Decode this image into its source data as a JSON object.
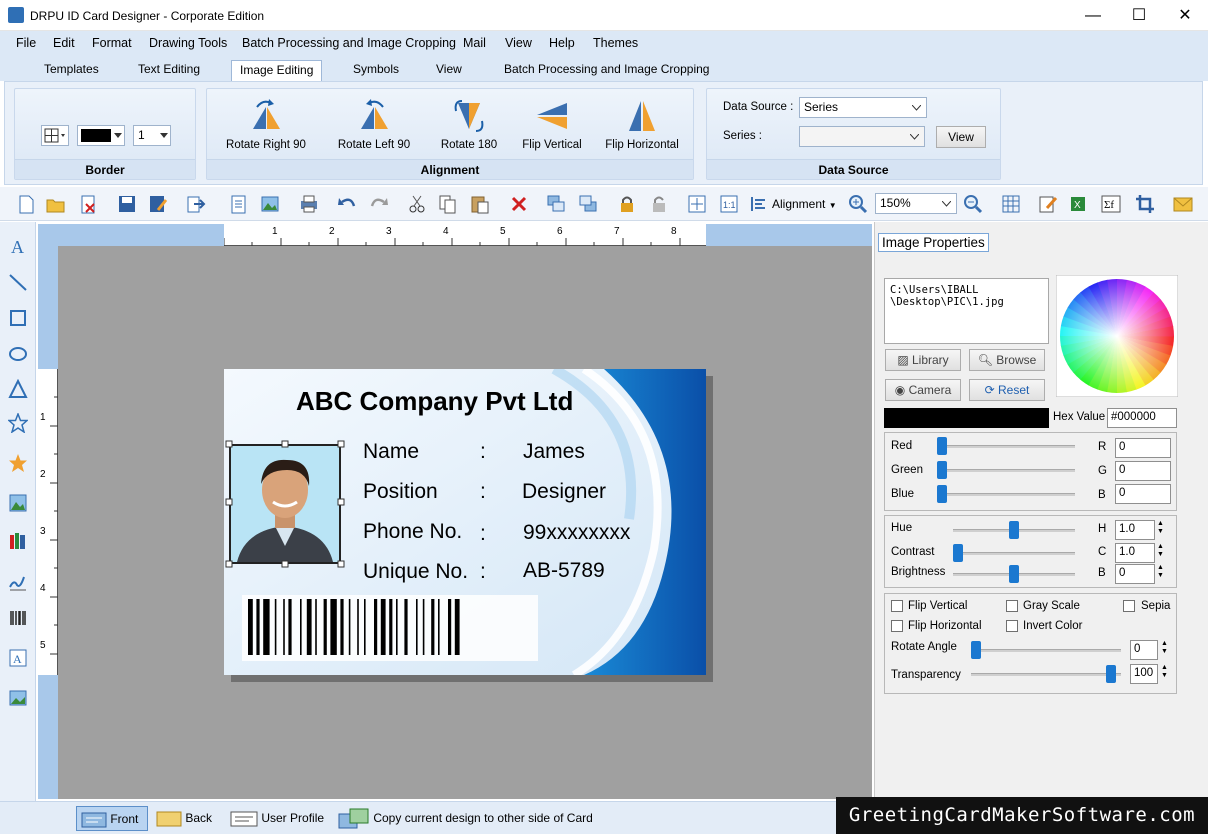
{
  "window": {
    "title": "DRPU ID Card Designer - Corporate Edition",
    "minimize": "—",
    "maximize": "☐",
    "close": "✕"
  },
  "menu": [
    "File",
    "Edit",
    "Format",
    "Drawing Tools",
    "Batch Processing and Image Cropping",
    "Mail",
    "View",
    "Help",
    "Themes"
  ],
  "tabs": [
    "Templates",
    "Text Editing",
    "Image Editing",
    "Symbols",
    "View",
    "Batch Processing and Image Cropping"
  ],
  "active_tab": "Image Editing",
  "ribbon": {
    "border": {
      "label": "Border",
      "color": "#000000",
      "width_value": "1"
    },
    "alignment": {
      "label": "Alignment",
      "buttons": [
        "Rotate Right 90",
        "Rotate Left 90",
        "Rotate 180",
        "Flip Vertical",
        "Flip Horizontal"
      ]
    },
    "data_source": {
      "label": "Data Source",
      "source_label": "Data Source :",
      "source_value": "Series",
      "series_label": "Series :",
      "series_value": "",
      "view_button": "View"
    }
  },
  "toolbar": {
    "alignment_label": "Alignment",
    "zoom": "150%"
  },
  "ruler": {
    "h": [
      "1",
      "2",
      "3",
      "4",
      "5",
      "6",
      "7",
      "8"
    ],
    "v": [
      "1",
      "2",
      "3",
      "4",
      "5"
    ]
  },
  "card": {
    "company": "ABC Company Pvt Ltd",
    "fields": [
      {
        "label": "Name",
        "sep": ":",
        "value": "James"
      },
      {
        "label": "Position",
        "sep": ":",
        "value": "Designer"
      },
      {
        "label": "Phone No.",
        "sep": ":",
        "value": "99xxxxxxxx"
      },
      {
        "label": "Unique No.",
        "sep": ":",
        "value": "AB-5789"
      }
    ]
  },
  "image_properties": {
    "title": "Image Properties",
    "path": "C:\\Users\\IBALL\n\\Desktop\\PIC\\1.jpg",
    "buttons": {
      "library": "Library",
      "browse": "Browse",
      "camera": "Camera",
      "reset": "Reset"
    },
    "hex_label": "Hex Value",
    "hex_value": "#000000",
    "rgb": [
      {
        "name": "Red",
        "key": "R",
        "value": "0"
      },
      {
        "name": "Green",
        "key": "G",
        "value": "0"
      },
      {
        "name": "Blue",
        "key": "B",
        "value": "0"
      }
    ],
    "adjust": [
      {
        "name": "Hue",
        "key": "H",
        "value": "1.0"
      },
      {
        "name": "Contrast",
        "key": "C",
        "value": "1.0"
      },
      {
        "name": "Brightness",
        "key": "B",
        "value": "0"
      }
    ],
    "checkboxes": [
      "Flip Vertical",
      "Gray Scale",
      "Sepia",
      "Flip Horizontal",
      "Invert Color"
    ],
    "rotate_label": "Rotate Angle",
    "rotate_value": "0",
    "transparency_label": "Transparency",
    "transparency_value": "100"
  },
  "statusbar": {
    "front": "Front",
    "back": "Back",
    "user_profile": "User Profile",
    "copy": "Copy current design to other side of Card"
  },
  "watermark": "GreetingCardMakerSoftware.com"
}
